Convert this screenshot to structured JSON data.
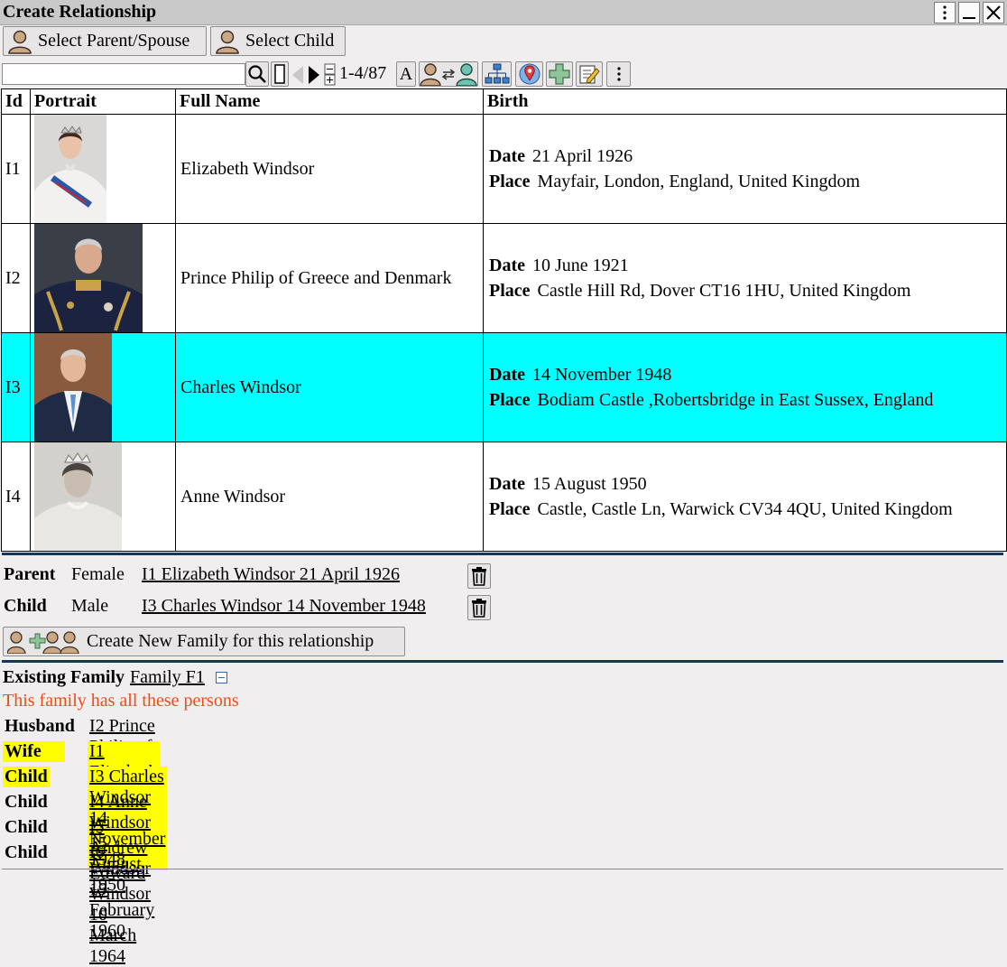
{
  "window": {
    "title": "Create Relationship"
  },
  "select_buttons": {
    "parent_spouse": "Select Parent/Spouse",
    "child": "Select Child"
  },
  "toolbar": {
    "search_value": "",
    "count": "1-4/87",
    "text_size_label": "A"
  },
  "table": {
    "headers": {
      "id": "Id",
      "portrait": "Portrait",
      "full_name": "Full Name",
      "birth": "Birth"
    },
    "date_label": "Date",
    "place_label": "Place",
    "rows": [
      {
        "id": "I1",
        "full_name": "Elizabeth Windsor",
        "birth_date": "21 April 1926",
        "birth_place": "Mayfair, London, England, United Kingdom"
      },
      {
        "id": "I2",
        "full_name": "Prince Philip of Greece and Denmark",
        "birth_date": "10 June 1921",
        "birth_place": "Castle Hill Rd, Dover CT16 1HU, United Kingdom"
      },
      {
        "id": "I3",
        "full_name": "Charles Windsor",
        "birth_date": "14 November 1948",
        "birth_place": "Bodiam Castle ,Robertsbridge in East Sussex, England"
      },
      {
        "id": "I4",
        "full_name": "Anne Windsor",
        "birth_date": "15 August 1950",
        "birth_place": "Castle, Castle Ln, Warwick CV34 4QU, United Kingdom"
      }
    ]
  },
  "relationship": {
    "parent": {
      "role": "Parent",
      "sex": "Female",
      "person": "I1 Elizabeth Windsor 21 April 1926"
    },
    "child": {
      "role": "Child",
      "sex": "Male",
      "person": "I3 Charles Windsor 14 November 1948"
    },
    "create_family_label": "Create New Family for this relationship"
  },
  "existing_family": {
    "label": "Existing Family",
    "family_link": "Family F1",
    "note": "This family has all these persons",
    "note_color": "#f04a1c",
    "highlight_color": "#ffff00",
    "members": [
      {
        "role": "Husband",
        "person": "I2 Prince Philip of Greece and Denmark 10 June 1921"
      },
      {
        "role": "Wife",
        "person": "I1 Elizabeth Windsor 21 April 1926"
      },
      {
        "role": "Child",
        "person": "I3 Charles Windsor 14 November 1948"
      },
      {
        "role": "Child",
        "person": "I4 Anne Windsor 15 August 1950"
      },
      {
        "role": "Child",
        "person": "I5 Andrew Windsor 19 February 1960"
      },
      {
        "role": "Child",
        "person": "I6 Edward Windsor 10 March 1964"
      }
    ]
  },
  "selected_row_color": "#00ffff"
}
